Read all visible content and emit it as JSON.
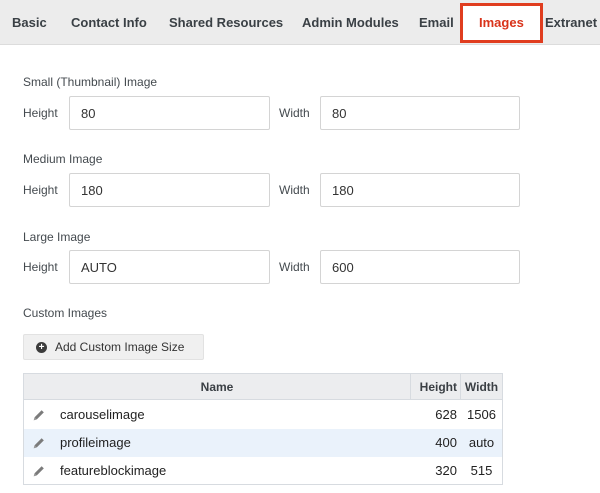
{
  "tabs": [
    {
      "label": "Basic",
      "active": false
    },
    {
      "label": "Contact Info",
      "active": false
    },
    {
      "label": "Shared Resources",
      "active": false
    },
    {
      "label": "Admin Modules",
      "active": false
    },
    {
      "label": "Email",
      "active": false
    },
    {
      "label": "Images",
      "active": true
    },
    {
      "label": "Extranet",
      "active": false
    }
  ],
  "accent_color": "#e03d1f",
  "sections": [
    {
      "title": "Small (Thumbnail) Image",
      "height_label": "Height",
      "height_value": "80",
      "width_label": "Width",
      "width_value": "80"
    },
    {
      "title": "Medium Image",
      "height_label": "Height",
      "height_value": "180",
      "width_label": "Width",
      "width_value": "180"
    },
    {
      "title": "Large Image",
      "height_label": "Height",
      "height_value": "AUTO",
      "width_label": "Width",
      "width_value": "600"
    }
  ],
  "custom": {
    "title": "Custom Images",
    "add_button_label": "Add Custom Image Size",
    "add_button_icon": "plus-circle-icon",
    "table": {
      "columns": [
        "Name",
        "Height",
        "Width"
      ],
      "rows": [
        {
          "name": "carouselimage",
          "height": "628",
          "width": "1506"
        },
        {
          "name": "profileimage",
          "height": "400",
          "width": "auto"
        },
        {
          "name": "featureblockimage",
          "height": "320",
          "width": "515"
        }
      ],
      "row_icon": "pencil-icon"
    }
  }
}
